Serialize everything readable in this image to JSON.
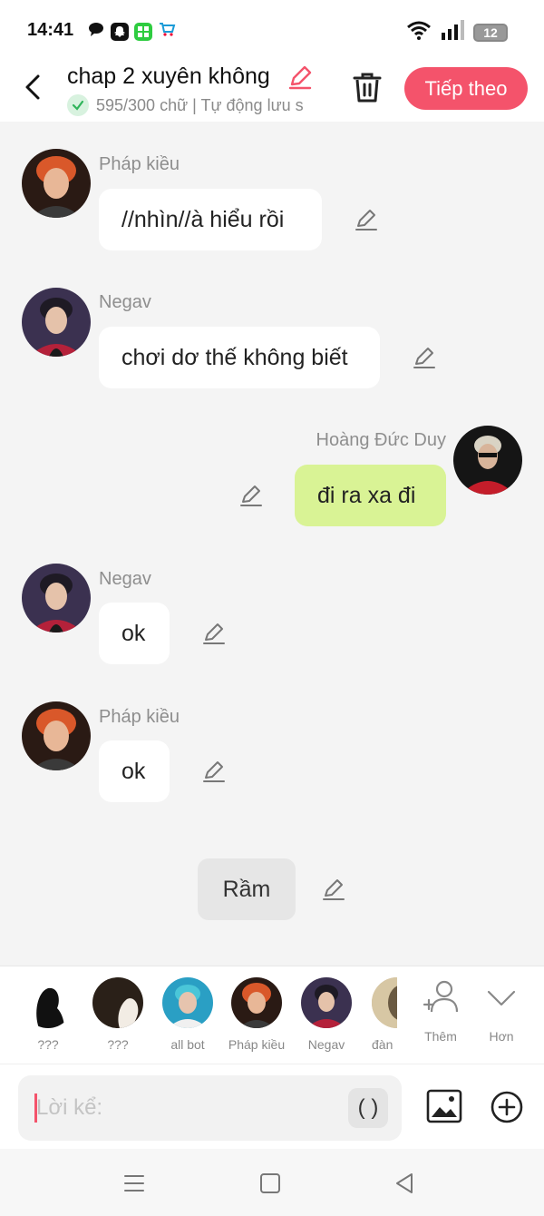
{
  "status_bar": {
    "time": "14:41",
    "battery": "12",
    "icons": [
      "message-icon",
      "snapchat-icon",
      "grid-app-icon",
      "cart-app-icon",
      "wifi-icon",
      "signal-icon",
      "battery-icon"
    ]
  },
  "header": {
    "title": "chap 2 xuyên không",
    "subtitle": "595/300 chữ | Tự động lưu s",
    "next_label": "Tiếp theo",
    "accent": "#f4536b"
  },
  "messages": [
    {
      "sender": "Pháp kiều",
      "text": "//nhìn//à hiểu rồi",
      "side": "left"
    },
    {
      "sender": "Negav",
      "text": "chơi dơ thế không biết",
      "side": "left"
    },
    {
      "sender": "Hoàng Đức Duy",
      "text": "đi ra xa đi",
      "side": "right",
      "bubble_color": "#d9f395"
    },
    {
      "sender": "Negav",
      "text": "ok",
      "side": "left"
    },
    {
      "sender": "Pháp kiều",
      "text": "ok",
      "side": "left"
    }
  ],
  "narration": {
    "text": "Rầm"
  },
  "characters": [
    {
      "label": "???"
    },
    {
      "label": "???"
    },
    {
      "label": "all bot"
    },
    {
      "label": "Pháp kiều"
    },
    {
      "label": "Negav"
    },
    {
      "label": "đàn"
    }
  ],
  "character_actions": {
    "add_label": "Thêm",
    "more_label": "Hơn"
  },
  "composer": {
    "placeholder": "Lời kể:",
    "paren_label": "( )"
  }
}
